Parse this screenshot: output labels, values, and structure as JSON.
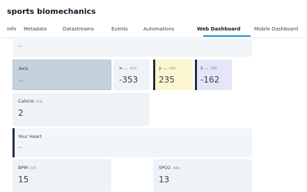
{
  "app": {
    "title": "sports biomechanics"
  },
  "tabs": [
    {
      "label": "Info"
    },
    {
      "label": "Metadata"
    },
    {
      "label": "Datastreams"
    },
    {
      "label": "Events"
    },
    {
      "label": "Automations"
    },
    {
      "label": "Web Dashboard"
    },
    {
      "label": "Mobile Dashboard"
    }
  ],
  "active_tab": "Web Dashboard",
  "widgets": {
    "top_placeholder": {
      "value": "--"
    },
    "axis": {
      "label": "Axis",
      "value": "--"
    },
    "x": {
      "label": "x-...",
      "pin": "(V3)",
      "value": "-353"
    },
    "y": {
      "label": "y ...",
      "pin": "(V4)",
      "value": "235",
      "accent": "#f5e08a"
    },
    "z": {
      "label": "z ...",
      "pin": "(V5)",
      "value": "-162",
      "accent": "#8b8fd6"
    },
    "calorie": {
      "label": "Calorie",
      "pin": "(V1)",
      "value": "2"
    },
    "your_heart": {
      "label": "Your Heart",
      "value": "--"
    },
    "bpm": {
      "label": "BPM",
      "pin": "(V7)",
      "value": "15"
    },
    "spo2": {
      "label": "SPO2",
      "pin": "(V8)",
      "value": "13"
    }
  },
  "colors": {
    "accent_blue": "#1e88c7",
    "axis_bg": "#c5d1dd",
    "y_bg": "#fbf6cf",
    "z_bg": "#e4e5f6",
    "dark_bar": "#1f2a44"
  }
}
